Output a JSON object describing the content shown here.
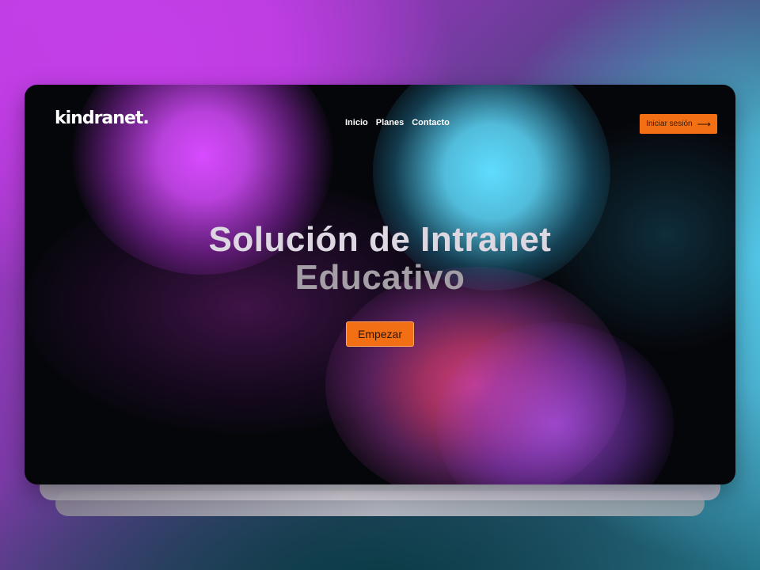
{
  "brand": {
    "logo_text": "kindranet."
  },
  "nav": {
    "items": [
      {
        "label": "Inicio"
      },
      {
        "label": "Planes"
      },
      {
        "label": "Contacto"
      }
    ],
    "login_label": "Iniciar sesión",
    "login_icon": "arrow-right-icon"
  },
  "hero": {
    "title_line1": "Solución de Intranet",
    "title_line2": "Educativo",
    "cta_label": "Empezar"
  },
  "colors": {
    "accent": "#f36f14",
    "window_bg": "#05060a",
    "magenta": "#d74bff",
    "cyan": "#5fdcff"
  }
}
